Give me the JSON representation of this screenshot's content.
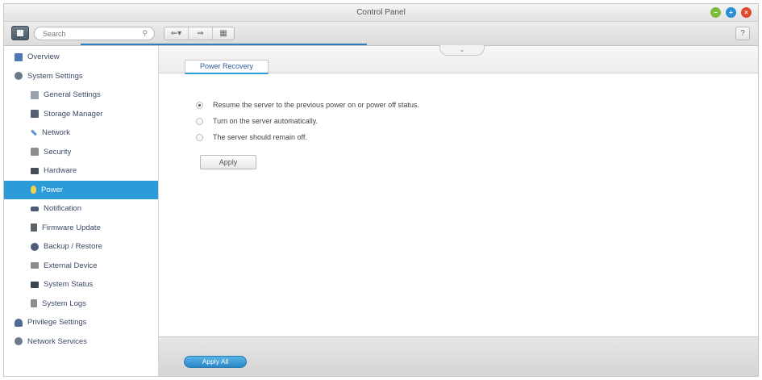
{
  "window": {
    "title": "Control Panel",
    "buttons": {
      "minimize_color": "#7dbb3c",
      "maximize_color": "#2b8fd6",
      "close_color": "#e04a2d"
    }
  },
  "toolbar": {
    "search_placeholder": "Search",
    "search_glyph": "⚲",
    "back_glyph": "⇐▾",
    "forward_glyph": "⇒",
    "grid_glyph": "▦",
    "help_glyph": "?"
  },
  "sidebar": {
    "active_color": "#2b9cd8",
    "items": [
      {
        "label": "Overview",
        "level": "top",
        "icon": "overview-icon",
        "color": "#4f79b4"
      },
      {
        "label": "System Settings",
        "level": "top",
        "icon": "gear-icon",
        "color": "#6c7a8c"
      },
      {
        "label": "General Settings",
        "level": "sub",
        "icon": "settings-icon",
        "color": "#9aa3ad"
      },
      {
        "label": "Storage Manager",
        "level": "sub",
        "icon": "storage-icon",
        "color": "#556070"
      },
      {
        "label": "Network",
        "level": "sub",
        "icon": "network-icon",
        "color": "#5b8fd0"
      },
      {
        "label": "Security",
        "level": "sub",
        "icon": "lock-icon",
        "color": "#8c8c8c"
      },
      {
        "label": "Hardware",
        "level": "sub",
        "icon": "hardware-icon",
        "color": "#444c58"
      },
      {
        "label": "Power",
        "level": "sub",
        "icon": "bulb-icon",
        "color": "#f3d24b",
        "active": true
      },
      {
        "label": "Notification",
        "level": "sub",
        "icon": "notification-icon",
        "color": "#4a5a70"
      },
      {
        "label": "Firmware Update",
        "level": "sub",
        "icon": "firmware-icon",
        "color": "#5a6268"
      },
      {
        "label": "Backup / Restore",
        "level": "sub",
        "icon": "backup-icon",
        "color": "#4c5e78"
      },
      {
        "label": "External Device",
        "level": "sub",
        "icon": "external-device-icon",
        "color": "#8c8c8c"
      },
      {
        "label": "System Status",
        "level": "sub",
        "icon": "monitor-icon",
        "color": "#3c4450"
      },
      {
        "label": "System Logs",
        "level": "sub",
        "icon": "logs-icon",
        "color": "#8c8c8c"
      },
      {
        "label": "Privilege Settings",
        "level": "top",
        "icon": "user-icon",
        "color": "#4f6a94"
      },
      {
        "label": "Network Services",
        "level": "top",
        "icon": "globe-icon",
        "color": "#6c7a8c"
      }
    ]
  },
  "main": {
    "collapse_glyph": "⌄",
    "tab_label": "Power Recovery",
    "options": [
      {
        "label": "Resume the server to the previous power on or power off status.",
        "checked": true
      },
      {
        "label": "Turn on the server automatically.",
        "checked": false
      },
      {
        "label": "The server should remain off.",
        "checked": false
      }
    ],
    "apply_label": "Apply"
  },
  "footer": {
    "apply_all_label": "Apply All"
  }
}
